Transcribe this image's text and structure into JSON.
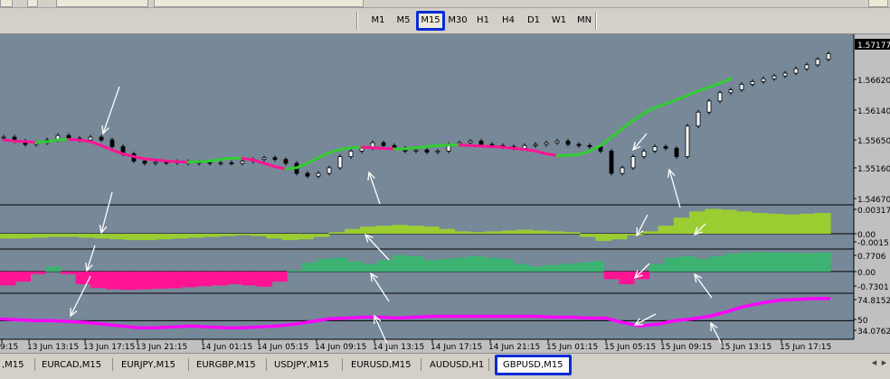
{
  "toolbar": {
    "timeframes": [
      "M1",
      "M5",
      "M15",
      "M30",
      "H1",
      "H4",
      "D1",
      "W1",
      "MN"
    ],
    "active_timeframe": "M15"
  },
  "symbol_tabs": {
    "tabs": [
      ",M15",
      "EURCAD,M15",
      "EURJPY,M15",
      "EURGBP,M15",
      "USDJPY,M15",
      "EURUSD,M15",
      "AUDUSD,H1",
      "GBPUSD,M15"
    ],
    "active_tab": "GBPUSD,M15"
  },
  "colors": {
    "chart_background": "#778899",
    "candle": "#000000",
    "ma_up": "#32cd32",
    "ma_down": "#ff1493",
    "histogram_1": "#9acd32",
    "histogram_2_up": "#3cb371",
    "histogram_2_down": "#ff1493",
    "line_indicator": "#ff00ff",
    "arrows": "#ffffff",
    "active_highlight": "#0a2bd6"
  },
  "chart_data": {
    "type": "line",
    "symbol": "GBPUSD",
    "timeframe": "M15",
    "x_tick_labels": [
      "9:15",
      "13 Jun 13:15",
      "13 Jun 17:15",
      "13 Jun 21:15",
      "14 Jun 01:15",
      "14 Jun 05:15",
      "14 Jun 09:15",
      "14 Jun 13:15",
      "14 Jun 17:15",
      "14 Jun 21:15",
      "15 Jun 01:15",
      "15 Jun 05:15",
      "15 Jun 09:15",
      "15 Jun 13:15",
      "15 Jun 17:15"
    ],
    "main_pane": {
      "y_tick_labels": [
        "1.57177",
        "1.56620",
        "1.56140",
        "1.55650",
        "1.55160",
        "1.54670"
      ],
      "current_price": "1.57177",
      "ylim": [
        1.5445,
        1.5745
      ],
      "price_series": [
        1.5565,
        1.5558,
        1.5552,
        1.5555,
        1.556,
        1.5568,
        1.5563,
        1.556,
        1.5565,
        1.556,
        1.5548,
        1.5535,
        1.5522,
        1.5518,
        1.552,
        1.5519,
        1.5521,
        1.5518,
        1.552,
        1.5518,
        1.5519,
        1.5518,
        1.5522,
        1.5525,
        1.5528,
        1.5525,
        1.5518,
        1.55,
        1.5495,
        1.55,
        1.551,
        1.553,
        1.554,
        1.5545,
        1.5555,
        1.555,
        1.5545,
        1.554,
        1.5542,
        1.5538,
        1.554,
        1.5552,
        1.5555,
        1.5558,
        1.5552,
        1.555,
        1.5548,
        1.5545,
        1.555,
        1.5552,
        1.5555,
        1.5558,
        1.5552,
        1.555,
        1.5548,
        1.554,
        1.55,
        1.551,
        1.553,
        1.554,
        1.5548,
        1.5545,
        1.553,
        1.5585,
        1.561,
        1.563,
        1.5645,
        1.565,
        1.566,
        1.5665,
        1.567,
        1.5675,
        1.568,
        1.5688,
        1.5695,
        1.5705,
        1.5715
      ],
      "ma_series": [
        1.556,
        1.5558,
        1.5557,
        1.5556,
        1.5557,
        1.556,
        1.5561,
        1.556,
        1.5557,
        1.555,
        1.5542,
        1.5535,
        1.553,
        1.5526,
        1.5524,
        1.5522,
        1.5521,
        1.552,
        1.5521,
        1.5522,
        1.5525,
        1.5527,
        1.5527,
        1.5524,
        1.5518,
        1.5512,
        1.5508,
        1.551,
        1.5518,
        1.5528,
        1.5537,
        1.5543,
        1.5546,
        1.5547,
        1.5546,
        1.5545,
        1.5544,
        1.5544,
        1.5546,
        1.5548,
        1.555,
        1.5551,
        1.5551,
        1.555,
        1.5549,
        1.5548,
        1.5547,
        1.5545,
        1.5543,
        1.554,
        1.5535,
        1.5532,
        1.5532,
        1.5534,
        1.554,
        1.555,
        1.5565,
        1.558,
        1.5595,
        1.5608,
        1.5618,
        1.5625,
        1.5632,
        1.564,
        1.5648,
        1.5655,
        1.5662,
        1.567
      ]
    },
    "indicator_1": {
      "y_tick_labels": [
        "0.003171",
        "0.00",
        "-0.0015"
      ],
      "ylim": [
        -0.0018,
        0.0035
      ],
      "values": [
        -0.0006,
        -0.0006,
        -0.0005,
        -0.0004,
        -0.0004,
        -0.0005,
        -0.0006,
        -0.0007,
        -0.0008,
        -0.0008,
        -0.0007,
        -0.0006,
        -0.0005,
        -0.0004,
        -0.0003,
        -0.0002,
        -0.0003,
        -0.0006,
        -0.0008,
        -0.0007,
        -0.0004,
        0.0002,
        0.0006,
        0.0009,
        0.001,
        0.0011,
        0.001,
        0.0009,
        0.0006,
        0.0003,
        0.0002,
        0.0003,
        0.0004,
        0.0005,
        0.0004,
        0.0003,
        0.0002,
        -0.0004,
        -0.0009,
        -0.0007,
        -0.0002,
        0.0003,
        0.001,
        0.002,
        0.0028,
        0.0031,
        0.003,
        0.0028,
        0.0026,
        0.0025,
        0.0024,
        0.0025,
        0.0026
      ]
    },
    "indicator_2": {
      "y_tick_labels": [
        "0.7706",
        "0.00",
        "-0.7301"
      ],
      "ylim": [
        -0.82,
        0.85
      ],
      "values": [
        -0.55,
        -0.4,
        -0.1,
        0.2,
        -0.1,
        -0.5,
        -0.65,
        -0.7,
        -0.72,
        -0.7,
        -0.68,
        -0.66,
        -0.62,
        -0.58,
        -0.55,
        -0.5,
        -0.55,
        -0.6,
        -0.4,
        0.05,
        0.35,
        0.5,
        0.55,
        0.4,
        0.3,
        0.45,
        0.65,
        0.6,
        0.45,
        0.5,
        0.55,
        0.6,
        0.55,
        0.5,
        0.3,
        0.2,
        0.25,
        0.3,
        0.35,
        0.4,
        -0.3,
        -0.5,
        -0.3,
        0.3,
        0.55,
        0.6,
        0.5,
        0.6,
        0.7,
        0.75,
        0.77,
        0.75,
        0.74,
        0.73,
        0.75
      ]
    },
    "indicator_3": {
      "y_tick_labels": [
        "74.8152",
        "50",
        "34.0762"
      ],
      "ylim": [
        30,
        80
      ],
      "values": [
        52,
        51,
        50,
        50,
        49,
        48,
        46,
        44,
        42,
        42,
        43,
        44,
        43,
        42,
        42,
        43,
        44,
        46,
        49,
        52,
        53,
        54,
        54,
        53,
        54,
        55,
        55,
        55,
        55,
        55,
        55,
        55,
        54,
        54,
        53,
        53,
        48,
        44,
        46,
        50,
        52,
        55,
        60,
        66,
        70,
        73,
        74,
        75,
        75
      ]
    },
    "annotations": "white arrows marking signals"
  }
}
